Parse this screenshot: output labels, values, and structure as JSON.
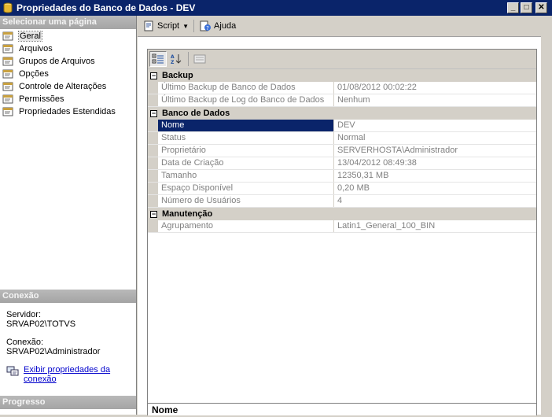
{
  "window": {
    "title": "Propriedades do Banco de Dados - DEV",
    "controls": {
      "minimize": "_",
      "maximize": "□",
      "close": "✕"
    }
  },
  "left": {
    "select_page_header": "Selecionar uma página",
    "pages": [
      {
        "label": "Geral",
        "selected": true
      },
      {
        "label": "Arquivos"
      },
      {
        "label": "Grupos de Arquivos"
      },
      {
        "label": "Opções"
      },
      {
        "label": "Controle de Alterações"
      },
      {
        "label": "Permissões"
      },
      {
        "label": "Propriedades Estendidas"
      }
    ],
    "connection_header": "Conexão",
    "server_label": "Servidor:",
    "server_value": "SRVAP02\\TOTVS",
    "connection_label": "Conexão:",
    "connection_value": "SRVAP02\\Administrador",
    "view_props_link_1": "Exibir propriedades da",
    "view_props_link_2": "conexão",
    "progress_header": "Progresso"
  },
  "toolbar": {
    "script_label": "Script",
    "help_label": "Ajuda"
  },
  "grid": {
    "categories": [
      {
        "name": "Backup",
        "toggle": "⊟",
        "rows": [
          {
            "name": "Último Backup de Banco de Dados",
            "value": "01/08/2012 00:02:22"
          },
          {
            "name": "Último Backup de Log do Banco de Dados",
            "value": "Nenhum"
          }
        ]
      },
      {
        "name": "Banco de Dados",
        "toggle": "⊟",
        "rows": [
          {
            "name": "Nome",
            "value": "DEV",
            "selected": true
          },
          {
            "name": "Status",
            "value": "Normal"
          },
          {
            "name": "Proprietário",
            "value": "SERVERHOSTA\\Administrador"
          },
          {
            "name": "Data de Criação",
            "value": "13/04/2012 08:49:38"
          },
          {
            "name": "Tamanho",
            "value": "12350,31 MB"
          },
          {
            "name": "Espaço Disponível",
            "value": "0,20 MB"
          },
          {
            "name": "Número de Usuários",
            "value": "4"
          }
        ]
      },
      {
        "name": "Manutenção",
        "toggle": "⊟",
        "rows": [
          {
            "name": "Agrupamento",
            "value": "Latin1_General_100_BIN"
          }
        ]
      }
    ],
    "description_title": "Nome"
  },
  "colors": {
    "title_bar": "#0a246a",
    "selection": "#0a246a",
    "link": "#0000cc",
    "section_header": "#a8a8a8"
  }
}
